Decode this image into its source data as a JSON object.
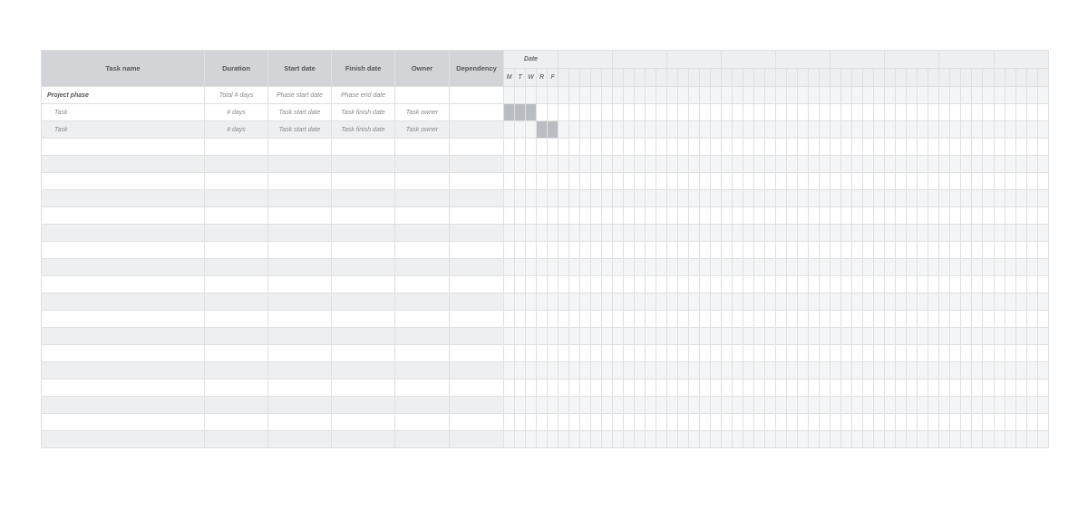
{
  "headers": {
    "task_name": "Task name",
    "duration": "Duration",
    "start_date": "Start date",
    "finish_date": "Finish date",
    "owner": "Owner",
    "dependency": "Dependency",
    "date": "Date"
  },
  "day_labels": [
    "M",
    "T",
    "W",
    "R",
    "F"
  ],
  "rows": [
    {
      "type": "phase",
      "name": "Project phase",
      "duration": "Total # days",
      "start": "Phase start date",
      "finish": "Phase end date",
      "owner": "",
      "dependency": "",
      "bar_start": null,
      "bar_len": 0
    },
    {
      "type": "task",
      "name": "Task",
      "duration": "# days",
      "start": "Task start date",
      "finish": "Task finish date",
      "owner": "Task owner",
      "dependency": "",
      "bar_start": 0,
      "bar_len": 3
    },
    {
      "type": "task",
      "name": "Task",
      "duration": "# days",
      "start": "Task start date",
      "finish": "Task finish date",
      "owner": "Task owner",
      "dependency": "",
      "bar_start": 3,
      "bar_len": 2
    }
  ],
  "empty_rows": 18,
  "timeline_weeks": 10,
  "timeline_days_per_week": 5
}
